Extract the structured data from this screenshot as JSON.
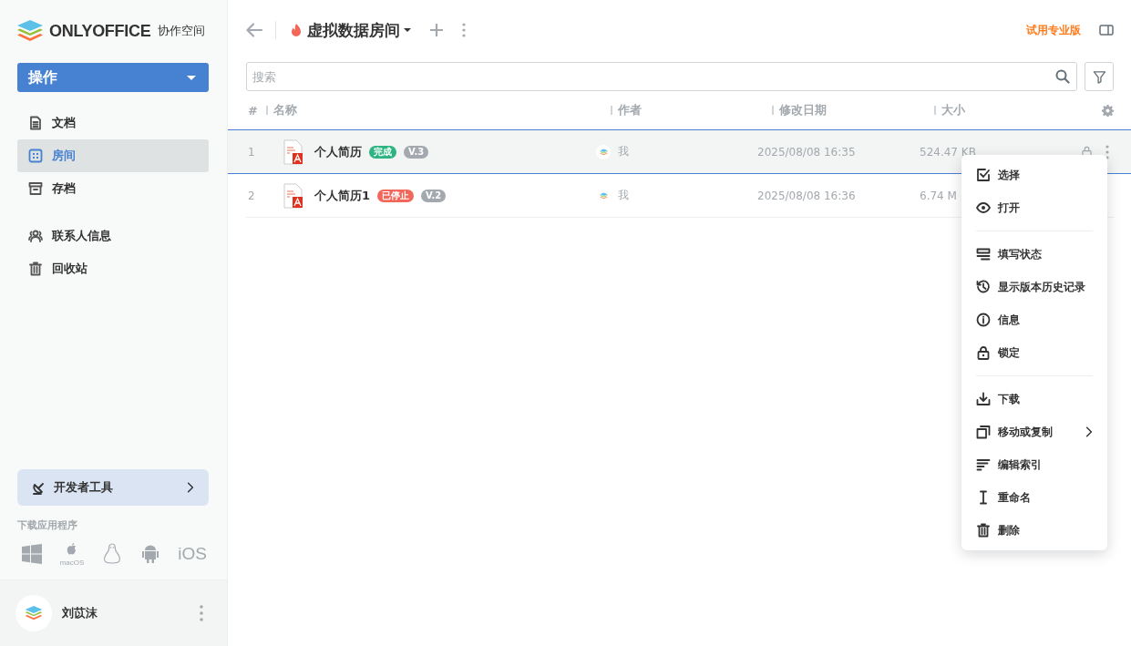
{
  "logo": {
    "wordmark": "ONLYOFFICE",
    "suffix": "协作空间"
  },
  "actions_button": "操作",
  "nav": [
    {
      "label": "文档",
      "kind": "documents",
      "selected": false
    },
    {
      "label": "房间",
      "kind": "rooms",
      "selected": true
    },
    {
      "label": "存档",
      "kind": "archive",
      "selected": false
    }
  ],
  "nav_secondary": [
    {
      "label": "联系人信息",
      "kind": "contacts"
    },
    {
      "label": "回收站",
      "kind": "trash"
    }
  ],
  "developer_tools": "开发者工具",
  "download_apps": {
    "title": "下载应用程序",
    "platforms": [
      {
        "kind": "windows"
      },
      {
        "kind": "macos",
        "label": "macOS"
      },
      {
        "kind": "linux"
      },
      {
        "kind": "android"
      },
      {
        "kind": "ios",
        "label": "iOS"
      }
    ]
  },
  "user": {
    "name": "刘苡沫"
  },
  "header": {
    "room_title": "虚拟数据房间",
    "trial_link": "试用专业版"
  },
  "search": {
    "placeholder": "搜索"
  },
  "table": {
    "columns": [
      "#",
      "名称",
      "作者",
      "修改日期",
      "大小"
    ],
    "rows": [
      {
        "index": "1",
        "name": "个人简历",
        "status": {
          "label": "完成",
          "color": "#2db482"
        },
        "version": "V.3",
        "author": "我",
        "modified": "2025/08/08 16:35",
        "size": "524.47 KB",
        "selected": true
      },
      {
        "index": "2",
        "name": "个人简历1",
        "status": {
          "label": "已停止",
          "color": "#f2675a"
        },
        "version": "V.2",
        "author": "我",
        "modified": "2025/08/08 16:36",
        "size": "6.74 M",
        "selected": false
      }
    ]
  },
  "context_menu": [
    {
      "kind": "check",
      "label": "选择",
      "submenu": false
    },
    {
      "kind": "eye",
      "label": "打开",
      "submenu": false
    },
    {
      "kind": "divider"
    },
    {
      "kind": "form",
      "label": "填写状态",
      "submenu": false
    },
    {
      "kind": "history",
      "label": "显示版本历史记录",
      "submenu": false
    },
    {
      "kind": "info",
      "label": "信息",
      "submenu": false
    },
    {
      "kind": "lock",
      "label": "锁定",
      "submenu": false
    },
    {
      "kind": "divider"
    },
    {
      "kind": "download",
      "label": "下载",
      "submenu": false
    },
    {
      "kind": "copy",
      "label": "移动或复制",
      "submenu": true
    },
    {
      "kind": "lines",
      "label": "编辑索引",
      "submenu": false
    },
    {
      "kind": "cursor",
      "label": "重命名",
      "submenu": false
    },
    {
      "kind": "trash",
      "label": "删除",
      "submenu": false
    }
  ]
}
